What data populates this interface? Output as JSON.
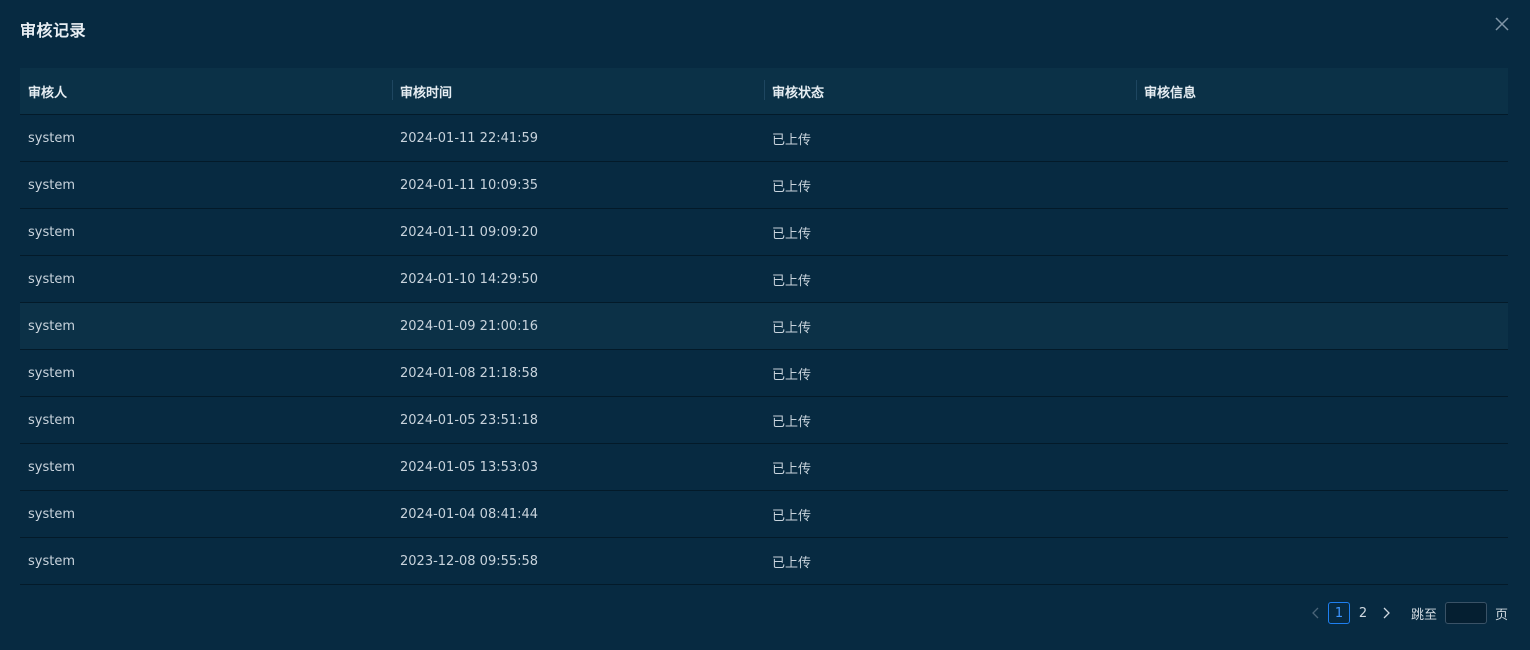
{
  "modal": {
    "title": "审核记录"
  },
  "table": {
    "headers": [
      "审核人",
      "审核时间",
      "审核状态",
      "审核信息"
    ],
    "rows": [
      [
        "system",
        "2024-01-11 22:41:59",
        "已上传",
        ""
      ],
      [
        "system",
        "2024-01-11 10:09:35",
        "已上传",
        ""
      ],
      [
        "system",
        "2024-01-11 09:09:20",
        "已上传",
        ""
      ],
      [
        "system",
        "2024-01-10 14:29:50",
        "已上传",
        ""
      ],
      [
        "system",
        "2024-01-09 21:00:16",
        "已上传",
        ""
      ],
      [
        "system",
        "2024-01-08 21:18:58",
        "已上传",
        ""
      ],
      [
        "system",
        "2024-01-05 23:51:18",
        "已上传",
        ""
      ],
      [
        "system",
        "2024-01-05 13:53:03",
        "已上传",
        ""
      ],
      [
        "system",
        "2024-01-04 08:41:44",
        "已上传",
        ""
      ],
      [
        "system",
        "2023-12-08 09:55:58",
        "已上传",
        ""
      ]
    ]
  },
  "pagination": {
    "pages": [
      "1",
      "2"
    ],
    "current_page": "1",
    "jump_label": "跳至",
    "jump_value": "",
    "page_unit": "页"
  },
  "icons": {
    "close": "close-icon",
    "prev": "chevron-left-icon",
    "next": "chevron-right-icon"
  },
  "colors": {
    "background": "#072a41",
    "header_bg": "#0b3147",
    "accent": "#1e7ff0"
  }
}
